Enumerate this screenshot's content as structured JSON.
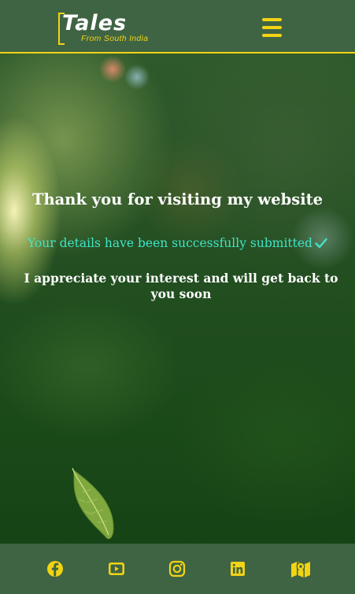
{
  "header": {
    "logo_title": "Tales",
    "logo_subtitle": "From South India",
    "menu_icon": "hamburger-menu-icon"
  },
  "main": {
    "heading": "Thank you for visiting my website",
    "success_message": "Your details have been successfully submitted",
    "success_icon": "checkmark-icon",
    "followup_message": "I appreciate your interest and will get back to you soon"
  },
  "footer": {
    "social_links": [
      {
        "icon": "facebook-icon"
      },
      {
        "icon": "youtube-icon"
      },
      {
        "icon": "instagram-icon"
      },
      {
        "icon": "linkedin-icon"
      },
      {
        "icon": "map-icon"
      }
    ]
  },
  "colors": {
    "accent_yellow": "#f2d414",
    "header_bg": "#3f6444",
    "success_text": "#41e5c7"
  }
}
